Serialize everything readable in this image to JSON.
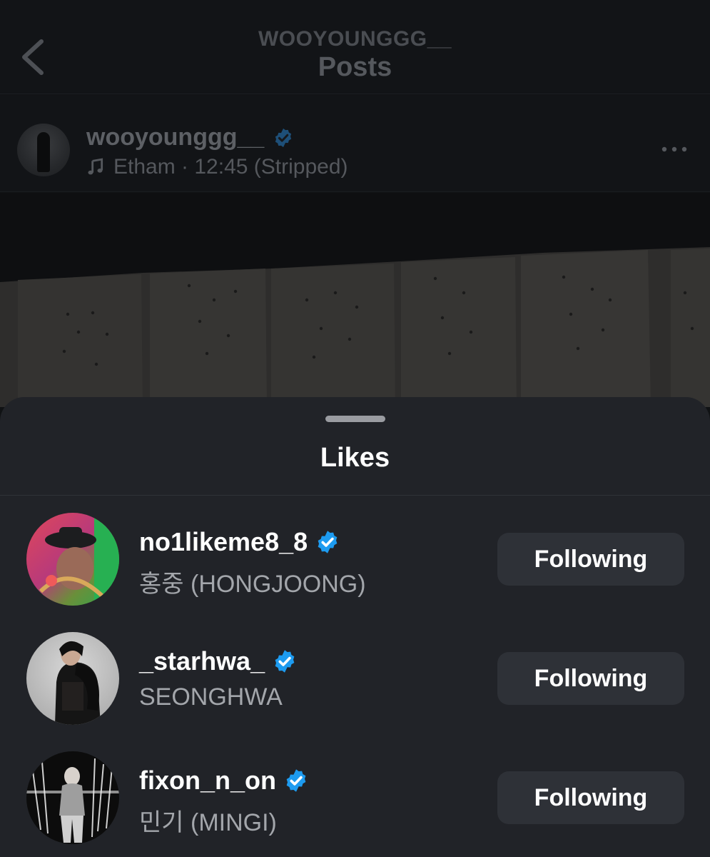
{
  "header": {
    "username": "WOOYOUNGGG__",
    "title": "Posts"
  },
  "post": {
    "username": "wooyounggg__",
    "music": "Etham · 12:45 (Stripped)"
  },
  "likes_sheet": {
    "title": "Likes",
    "users": [
      {
        "username": "no1likeme8_8",
        "full_name": "홍중 (HONGJOONG)",
        "button": "Following"
      },
      {
        "username": "_starhwa_",
        "full_name": "SEONGHWA",
        "button": "Following"
      },
      {
        "username": "fixon_n_on",
        "full_name": "민기 (MINGI)",
        "button": "Following"
      }
    ]
  },
  "colors": {
    "verified_badge": "#1d9bf0",
    "sheet_background": "#212328",
    "follow_button": "#2e3137"
  },
  "icons": [
    "chevron-left-icon",
    "verified-badge-icon",
    "music-note-icon",
    "more-horizontal-icon"
  ]
}
